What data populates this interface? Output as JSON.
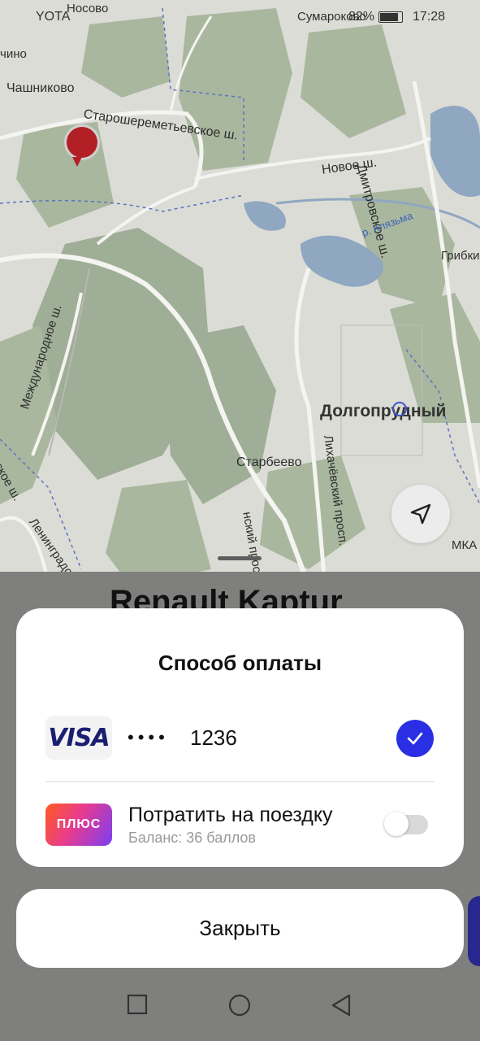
{
  "status_bar": {
    "carrier": "YOTA",
    "battery_pct": "82%",
    "time": "17:28"
  },
  "map": {
    "labels": {
      "nosovo": "Носово",
      "sumarokovo": "Сумароково",
      "chino": "чино",
      "chashnikovo": "Чашниково",
      "starosheremetyevskoe": "Старошереметьевское ш.",
      "novoe": "Новое ш.",
      "dmitrovskoe": "Дмитровское ш.",
      "klyazma": "р. Клязьма",
      "gribki": "Грибки",
      "mezhdunarodnoe": "Международное ш.",
      "dolgoprudny": "Долгопрудный",
      "starbeevo": "Старбеево",
      "likhachevsky": "Лихачёвский просп.",
      "leningradskoe": "Ленинградское ш.",
      "skoe": "ское ш.",
      "mka": "МКА",
      "prosp": "нский просп."
    },
    "colors": {
      "land": "#dcdcd6",
      "forest": "#9fae96",
      "water": "#8fa7c1",
      "road": "#f4f4f1"
    }
  },
  "sheet": {
    "car_title": "Renault Kaptur"
  },
  "dialog": {
    "title": "Способ оплаты",
    "card": {
      "brand": "VISA",
      "dots": "••••",
      "last4": "1236",
      "selected": true
    },
    "plus": {
      "logo": "ПЛЮС",
      "title": "Потратить на поездку",
      "subtitle": "Баланс: 36 баллов",
      "toggle_on": false
    }
  },
  "close_label": "Закрыть",
  "icons": {
    "navigation": "navigation-arrow-icon",
    "check": "check-icon",
    "recent": "square-icon",
    "home": "circle-icon",
    "back": "triangle-back-icon"
  },
  "accent": "#2a2fe4"
}
